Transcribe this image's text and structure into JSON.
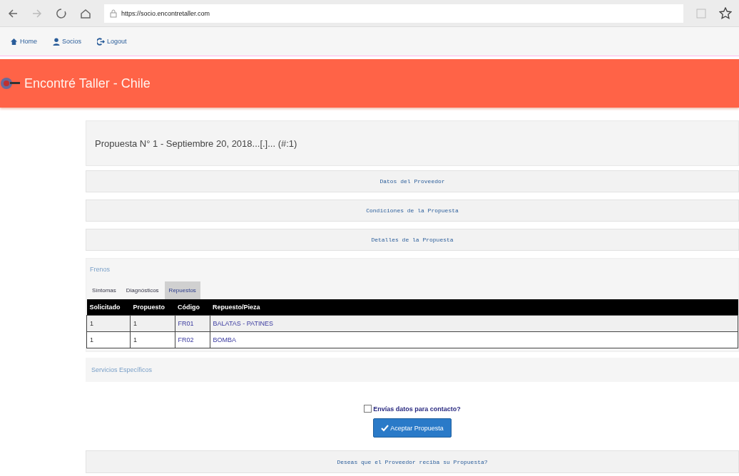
{
  "browser": {
    "url_domain": "https://socio.encontretaller.com"
  },
  "nav": [
    {
      "label": "Home",
      "kind": "home"
    },
    {
      "label": "Socios",
      "kind": "user"
    },
    {
      "label": "Logout",
      "kind": "logout"
    }
  ],
  "header": {
    "title": "Encontré Taller - Chile"
  },
  "proposal": {
    "title": "Propuesta N° 1 - Septiembre 20, 2018...[.]... (#:1)"
  },
  "panels": [
    "Datos del Proveedor",
    "Condiciones de la Propuesta",
    "Detalles de la Propuesta"
  ],
  "section": {
    "title": "Frenos",
    "tabs": [
      {
        "label": "Síntomas",
        "selected": false
      },
      {
        "label": "Diagnósticos",
        "selected": false
      },
      {
        "label": "Repuestos",
        "selected": true
      }
    ],
    "table": {
      "columns": [
        "Solicitado",
        "Propuesto",
        "Código",
        "Repuesto/Pieza"
      ],
      "rows": [
        [
          "1",
          "1",
          "FR01",
          "BALATAS - PATINES"
        ],
        [
          "1",
          "1",
          "FR02",
          "BOMBA"
        ]
      ]
    }
  },
  "services": {
    "title": "Servicios Específicos"
  },
  "contact": {
    "label": "Envías datos para contacto?",
    "checked": false
  },
  "accept_button": "Aceptar Propuesta",
  "footer_panel": "Deseas que el Proveedor reciba su Propuesta?"
}
